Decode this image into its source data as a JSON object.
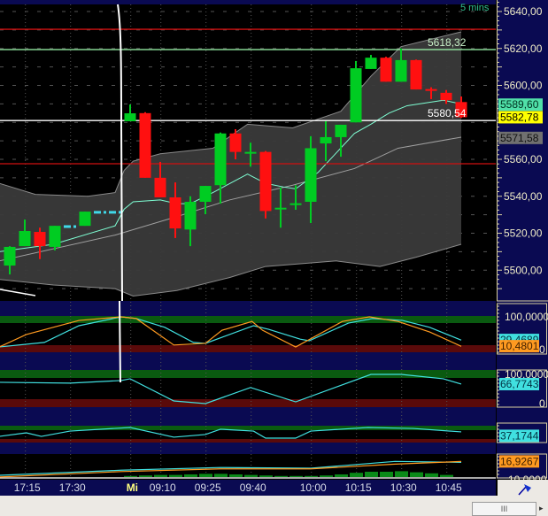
{
  "header": {
    "interval_label": "5 mins"
  },
  "colors": {
    "up": "#00cc22",
    "down": "#ff1010",
    "band": "#3a3a3a",
    "ma_fast": "#7fffd4",
    "ma_slow": "#a0a0a0",
    "axis_bg": "#0a0a52",
    "osc_cyan": "#40e0e0",
    "osc_orange": "#ff9a20"
  },
  "price_axis": {
    "labels": [
      "5640,00",
      "5620,00",
      "5600,00",
      "5560,00",
      "5540,00",
      "5520,00",
      "5500,00"
    ],
    "values": [
      5640,
      5620,
      5600,
      5560,
      5540,
      5520,
      5500
    ]
  },
  "price_badges": [
    {
      "text": "5589,60",
      "value": 5589.6,
      "bg": "#50e0a8",
      "fg": "#003020"
    },
    {
      "text": "5582,78",
      "value": 5582.78,
      "bg": "#ffff00",
      "fg": "#000000"
    },
    {
      "text": "5571,58",
      "value": 5571.58,
      "bg": "#707070",
      "fg": "#101010"
    }
  ],
  "chart_labels": {
    "upper": "5618,32",
    "lower": "5580,54"
  },
  "time_axis": {
    "labels": [
      "17:15",
      "17:30",
      "Mi",
      "09:10",
      "09:25",
      "09:40",
      "10:00",
      "10:15",
      "10:30",
      "10:45"
    ],
    "bar_index": [
      1.1,
      4.1,
      8.1,
      10.1,
      13.1,
      16.1,
      20.1,
      23.1,
      26.1,
      29.1
    ]
  },
  "chart_data": {
    "type": "candlestick",
    "ylim": [
      5483,
      5646
    ],
    "horizontal_lines": [
      {
        "price": 5630.4,
        "color": "#d01010"
      },
      {
        "price": 5619.4,
        "color": "#a0ffb0"
      },
      {
        "price": 5581.0,
        "color": "#ffffff"
      },
      {
        "price": 5557.6,
        "color": "#d01010"
      }
    ],
    "candles": [
      {
        "i": 0,
        "o": 5502.5,
        "h": 5513,
        "l": 5497.7,
        "c": 5512.6
      },
      {
        "i": 1,
        "o": 5513,
        "h": 5527.4,
        "l": 5513,
        "c": 5521.2
      },
      {
        "i": 2,
        "o": 5520.7,
        "h": 5523,
        "l": 5506,
        "c": 5513
      },
      {
        "i": 3,
        "o": 5512.6,
        "h": 5524,
        "l": 5510.7,
        "c": 5524
      },
      {
        "i": 4,
        "o": 5523.6,
        "h": 5523.6,
        "l": 5523.6,
        "c": 5523.6,
        "gap": true
      },
      {
        "i": 5,
        "o": 5524,
        "h": 5531.7,
        "l": 5524,
        "c": 5531.7
      },
      {
        "i": 6,
        "o": 5531.3,
        "h": 5531.3,
        "l": 5531.3,
        "c": 5531.3,
        "gap": true
      },
      {
        "i": 7,
        "o": 5531.3,
        "h": 5531.3,
        "l": 5531.3,
        "c": 5531.3,
        "gap": true
      },
      {
        "i": 8,
        "o": 5580.6,
        "h": 5589.7,
        "l": 5580.6,
        "c": 5584.9
      },
      {
        "i": 9,
        "o": 5585,
        "h": 5585.5,
        "l": 5550,
        "c": 5550
      },
      {
        "i": 10,
        "o": 5550,
        "h": 5558.6,
        "l": 5539.4,
        "c": 5539.4
      },
      {
        "i": 11,
        "o": 5539.4,
        "h": 5547.5,
        "l": 5517.4,
        "c": 5522.6
      },
      {
        "i": 12,
        "o": 5522,
        "h": 5540,
        "l": 5513,
        "c": 5537
      },
      {
        "i": 13,
        "o": 5537,
        "h": 5545.6,
        "l": 5530.3,
        "c": 5545.6
      },
      {
        "i": 14,
        "o": 5546,
        "h": 5574.5,
        "l": 5536,
        "c": 5574
      },
      {
        "i": 15,
        "o": 5574,
        "h": 5576.3,
        "l": 5560,
        "c": 5564
      },
      {
        "i": 16,
        "o": 5564,
        "h": 5569,
        "l": 5556,
        "c": 5564
      },
      {
        "i": 17,
        "o": 5564,
        "h": 5564.5,
        "l": 5528,
        "c": 5532
      },
      {
        "i": 18,
        "o": 5533.6,
        "h": 5544.7,
        "l": 5523,
        "c": 5533.8
      },
      {
        "i": 19,
        "o": 5536,
        "h": 5546,
        "l": 5532.7,
        "c": 5536.2
      },
      {
        "i": 20,
        "o": 5537,
        "h": 5572.5,
        "l": 5525.5,
        "c": 5566
      },
      {
        "i": 21,
        "o": 5568.6,
        "h": 5580.6,
        "l": 5559,
        "c": 5572
      },
      {
        "i": 22,
        "o": 5572,
        "h": 5578.7,
        "l": 5561.4,
        "c": 5578.7
      },
      {
        "i": 23,
        "o": 5580,
        "h": 5613.2,
        "l": 5580,
        "c": 5609.3
      },
      {
        "i": 24,
        "o": 5608.9,
        "h": 5616.5,
        "l": 5608.9,
        "c": 5615
      },
      {
        "i": 25,
        "o": 5615,
        "h": 5615.5,
        "l": 5602,
        "c": 5602
      },
      {
        "i": 26,
        "o": 5602,
        "h": 5620,
        "l": 5602,
        "c": 5613.7
      },
      {
        "i": 27,
        "o": 5613.7,
        "h": 5614,
        "l": 5597.8,
        "c": 5597.8
      },
      {
        "i": 28,
        "o": 5598,
        "h": 5599,
        "l": 5592.6,
        "c": 5597.8
      },
      {
        "i": 29,
        "o": 5596,
        "h": 5597.5,
        "l": 5590,
        "c": 5592
      },
      {
        "i": 30,
        "o": 5591,
        "h": 5594,
        "l": 5582.4,
        "c": 5582.78
      }
    ],
    "bollinger_upper": [
      [
        -0.7,
        5547
      ],
      [
        1.7,
        5541
      ],
      [
        5.2,
        5540
      ],
      [
        7,
        5542
      ],
      [
        7.6,
        5554
      ],
      [
        8.2,
        5559
      ],
      [
        10,
        5563
      ],
      [
        13.5,
        5566
      ],
      [
        15.8,
        5579
      ],
      [
        18.8,
        5577
      ],
      [
        22,
        5586
      ],
      [
        24,
        5605
      ],
      [
        26,
        5621
      ],
      [
        30,
        5629
      ]
    ],
    "bollinger_lower": [
      [
        -0.7,
        5495
      ],
      [
        2.9,
        5492
      ],
      [
        7,
        5490
      ],
      [
        8.2,
        5486
      ],
      [
        11.1,
        5489
      ],
      [
        14.6,
        5496
      ],
      [
        17,
        5502
      ],
      [
        21.7,
        5505
      ],
      [
        24.6,
        5502
      ],
      [
        27,
        5507
      ],
      [
        30,
        5514
      ]
    ],
    "ma_fast": [
      [
        -0.7,
        5510
      ],
      [
        2.9,
        5514
      ],
      [
        7,
        5524
      ],
      [
        7.6,
        5533
      ],
      [
        8.2,
        5537
      ],
      [
        10,
        5538
      ],
      [
        11.1,
        5536
      ],
      [
        12,
        5536
      ],
      [
        13.5,
        5542
      ],
      [
        15.8,
        5552
      ],
      [
        17,
        5547
      ],
      [
        18.2,
        5545
      ],
      [
        19,
        5544
      ],
      [
        20.5,
        5553
      ],
      [
        22.9,
        5574
      ],
      [
        24,
        5579
      ],
      [
        25.2,
        5585
      ],
      [
        26.4,
        5589
      ],
      [
        28.8,
        5592
      ],
      [
        30,
        5590
      ]
    ],
    "ma_slow": [
      [
        -0.7,
        5505
      ],
      [
        7,
        5519
      ],
      [
        11.1,
        5529
      ],
      [
        14.6,
        5538
      ],
      [
        18.8,
        5546
      ],
      [
        22.9,
        5555
      ],
      [
        25.8,
        5566
      ],
      [
        30,
        5572
      ]
    ]
  },
  "oscillators": [
    {
      "name": "stochastic",
      "axis_top": "100,0000",
      "axis_bottom": "0",
      "badges": [
        {
          "text": "29,4689",
          "bg": "#40e0e0",
          "fg": "#003040",
          "value": 29.47
        },
        {
          "text": "10,4801",
          "bg": "#ff9a20",
          "fg": "#402000",
          "value": 10.48
        }
      ],
      "series": [
        {
          "color": "#40e0e0",
          "points": [
            [
              -0.7,
              8
            ],
            [
              2.3,
              22
            ],
            [
              4.6,
              73
            ],
            [
              7.4,
              100
            ],
            [
              8.4,
              95
            ],
            [
              10.3,
              68
            ],
            [
              12.2,
              22
            ],
            [
              13,
              19
            ],
            [
              16.2,
              73
            ],
            [
              17.2,
              62
            ],
            [
              19.3,
              32
            ],
            [
              19.9,
              27
            ],
            [
              22.5,
              81
            ],
            [
              24.1,
              95
            ],
            [
              26.1,
              89
            ],
            [
              27.9,
              68
            ],
            [
              30,
              29
            ]
          ]
        },
        {
          "color": "#ff9a20",
          "points": [
            [
              -0.7,
              8
            ],
            [
              1.1,
              46
            ],
            [
              4.6,
              89
            ],
            [
              7.4,
              100
            ],
            [
              8.4,
              95
            ],
            [
              10.9,
              14
            ],
            [
              13,
              19
            ],
            [
              14.1,
              59
            ],
            [
              16.1,
              86
            ],
            [
              16.8,
              59
            ],
            [
              19,
              8
            ],
            [
              22.1,
              86
            ],
            [
              23.9,
              100
            ],
            [
              25.8,
              86
            ],
            [
              27.9,
              54
            ],
            [
              30,
              10
            ]
          ]
        }
      ]
    },
    {
      "name": "rsi",
      "axis_top": "100,0000",
      "axis_bottom": "0",
      "badges": [
        {
          "text": "66,7743",
          "bg": "#40e0e0",
          "fg": "#003040",
          "value": 66.77
        }
      ],
      "series": [
        {
          "color": "#40e0e0",
          "points": [
            [
              -0.7,
              73
            ],
            [
              4,
              70
            ],
            [
              7.4,
              79
            ],
            [
              8,
              85
            ],
            [
              10.9,
              9
            ],
            [
              13,
              0
            ],
            [
              16,
              55
            ],
            [
              19,
              6
            ],
            [
              24,
              100
            ],
            [
              26,
              100
            ],
            [
              28.8,
              85
            ],
            [
              30,
              67
            ]
          ]
        }
      ]
    },
    {
      "name": "momentum",
      "axis_top": "",
      "axis_bottom": "",
      "badges": [
        {
          "text": "37,1744",
          "bg": "#40e0e0",
          "fg": "#003040",
          "value": 37.17
        }
      ],
      "series": [
        {
          "color": "#40e0e0",
          "points": [
            [
              -0.7,
              33
            ],
            [
              1.1,
              60
            ],
            [
              2.1,
              33
            ],
            [
              4,
              73
            ],
            [
              8,
              100
            ],
            [
              10.9,
              27
            ],
            [
              13,
              47
            ],
            [
              14,
              87
            ],
            [
              16.2,
              73
            ],
            [
              17,
              20
            ],
            [
              19,
              20
            ],
            [
              20,
              73
            ],
            [
              23.8,
              100
            ],
            [
              26.8,
              93
            ],
            [
              30,
              67
            ]
          ]
        }
      ]
    },
    {
      "name": "macd",
      "axis_top": "",
      "axis_bottom": "-10,0000",
      "badges": [
        {
          "text": "16,9267",
          "bg": "#ff9a20",
          "fg": "#402000",
          "value": 16.93
        }
      ],
      "series": [
        {
          "color": "#40e0e0",
          "points": [
            [
              -0.7,
              -3.5
            ],
            [
              7.4,
              4
            ],
            [
              14,
              8
            ],
            [
              20,
              7
            ],
            [
              25.6,
              17
            ],
            [
              30,
              15.6
            ]
          ]
        },
        {
          "color": "#ff9a20",
          "points": [
            [
              -0.7,
              -6
            ],
            [
              7.4,
              2
            ],
            [
              14,
              6
            ],
            [
              20,
              6
            ],
            [
              25.6,
              13
            ],
            [
              30,
              16.9
            ]
          ]
        }
      ],
      "histogram": [
        [
          8,
          1
        ],
        [
          9,
          1.5
        ],
        [
          10,
          2
        ],
        [
          11,
          2
        ],
        [
          12,
          2.5
        ],
        [
          13,
          3
        ],
        [
          14,
          3
        ],
        [
          15,
          2.5
        ],
        [
          16,
          2
        ],
        [
          17,
          1.5
        ],
        [
          18,
          1
        ],
        [
          19,
          1
        ],
        [
          20,
          1
        ],
        [
          21,
          1.5
        ],
        [
          22,
          2.5
        ],
        [
          23,
          4
        ],
        [
          24,
          5
        ],
        [
          25,
          5
        ],
        [
          26,
          5.5
        ],
        [
          27,
          4.5
        ],
        [
          28,
          3.5
        ],
        [
          29,
          2
        ]
      ]
    }
  ],
  "scrollbar": {
    "thumb_label": "III"
  }
}
